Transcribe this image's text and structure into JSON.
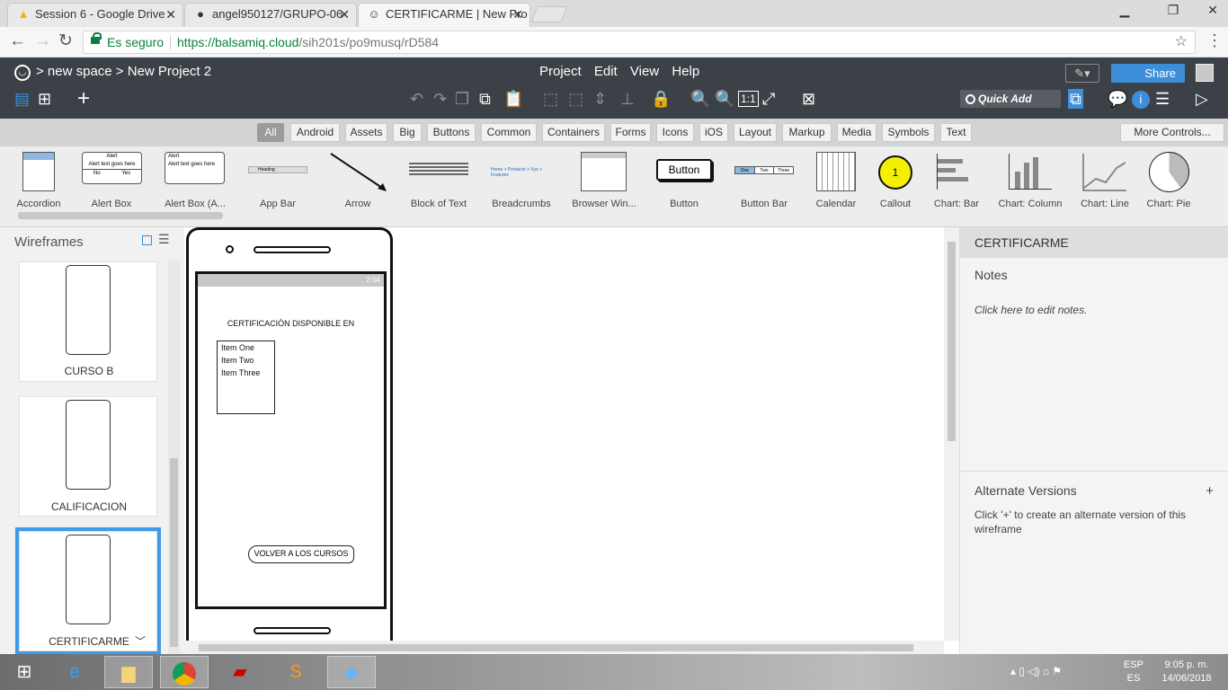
{
  "browser": {
    "tabs": [
      {
        "title": "Session 6 - Google Drive",
        "icon": "google-drive-icon"
      },
      {
        "title": "angel950127/GRUPO-06",
        "icon": "github-icon"
      },
      {
        "title": "CERTIFICARME | New Pro",
        "icon": "balsamiq-icon"
      }
    ],
    "secure_label": "Es seguro",
    "url_host": "https://balsamiq.cloud",
    "url_path": "/sih201s/po9musq/rD584"
  },
  "app": {
    "breadcrumb": "> new space > New Project 2",
    "menu": [
      "Project",
      "Edit",
      "View",
      "Help"
    ],
    "quick_add": "Quick Add",
    "share": "Share"
  },
  "categories": [
    "All",
    "Android",
    "Assets",
    "Big",
    "Buttons",
    "Common",
    "Containers",
    "Forms",
    "Icons",
    "iOS",
    "Layout",
    "Markup",
    "Media",
    "Symbols",
    "Text"
  ],
  "selected_category": "All",
  "more_controls": "More Controls...",
  "library": [
    "Accordion",
    "Alert Box",
    "Alert Box (A...",
    "App Bar",
    "Arrow",
    "Block of Text",
    "Breadcrumbs",
    "Browser Win...",
    "Button",
    "Button Bar",
    "Calendar",
    "Callout",
    "Chart: Bar",
    "Chart: Column",
    "Chart: Line",
    "Chart: Pie"
  ],
  "library_samples": {
    "alert_title": "Alert",
    "alert_text": "Alert text goes here",
    "alert_no": "No",
    "alert_yes": "Yes",
    "button": "Button",
    "button_bar": [
      "One",
      "Two",
      "Three"
    ],
    "callout": "1",
    "crumbs": "Home > Products > Xyz > Features",
    "app_bar": "Heading"
  },
  "wireframes": {
    "header": "Wireframes",
    "items": [
      {
        "name": "CURSO B"
      },
      {
        "name": "CALIFICACION"
      },
      {
        "name": "CERTIFICARME"
      }
    ]
  },
  "wireframe": {
    "status_time": "2:04",
    "title": "CERTIFICACIÓN DISPONIBLE EN",
    "list_items": [
      "Item One",
      "Item Two",
      "Item Three"
    ],
    "back_button": "VOLVER A LOS CURSOS"
  },
  "inspector": {
    "title": "CERTIFICARME",
    "notes_label": "Notes",
    "notes_hint": "Click here to edit notes.",
    "alt_label": "Alternate Versions",
    "alt_plus": "+",
    "alt_hint": "Click '+' to create an alternate version of this wireframe"
  },
  "taskbar": {
    "lang": "ESP",
    "lang2": "ES",
    "time": "9:05 p. m.",
    "date": "14/06/2018"
  }
}
